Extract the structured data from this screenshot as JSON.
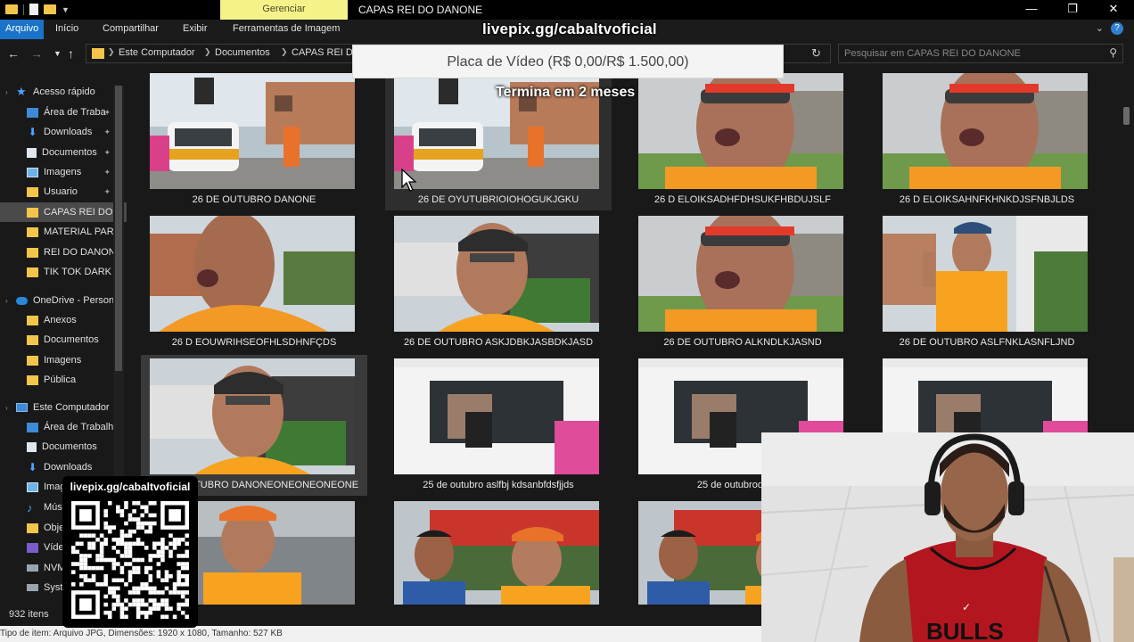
{
  "window": {
    "manage_tab": "Gerenciar",
    "title": "CAPAS REI DO DANONE"
  },
  "ribbon": {
    "tabs": [
      "Arquivo",
      "Início",
      "Compartilhar",
      "Exibir",
      "Ferramentas de Imagem"
    ]
  },
  "address": {
    "crumbs": [
      "Este Computador",
      "Documentos",
      "CAPAS REI DO"
    ]
  },
  "search": {
    "placeholder": "Pesquisar em CAPAS REI DO DANONE"
  },
  "sidebar": {
    "items": [
      {
        "label": "Acesso rápido",
        "icon": "star-icon",
        "pinned": false
      },
      {
        "label": "Área de Traba",
        "icon": "desktop-icon",
        "pinned": true
      },
      {
        "label": "Downloads",
        "icon": "download-icon",
        "pinned": true
      },
      {
        "label": "Documentos",
        "icon": "document-icon",
        "pinned": true
      },
      {
        "label": "Imagens",
        "icon": "image-icon",
        "pinned": true
      },
      {
        "label": "Usuario",
        "icon": "folder-icon",
        "pinned": true
      },
      {
        "label": "CAPAS REI DO D",
        "icon": "folder-icon",
        "pinned": false
      },
      {
        "label": "MATERIAL PARA",
        "icon": "folder-icon",
        "pinned": false
      },
      {
        "label": "REI DO DANONE",
        "icon": "folder-icon",
        "pinned": false
      },
      {
        "label": "TIK TOK DARK D",
        "icon": "folder-icon",
        "pinned": false
      },
      {
        "label": "OneDrive - Person",
        "icon": "cloud-icon",
        "pinned": false
      },
      {
        "label": "Anexos",
        "icon": "folder-icon",
        "pinned": false
      },
      {
        "label": "Documentos",
        "icon": "folder-icon",
        "pinned": false
      },
      {
        "label": "Imagens",
        "icon": "folder-icon",
        "pinned": false
      },
      {
        "label": "Pública",
        "icon": "folder-icon",
        "pinned": false
      },
      {
        "label": "Este Computador",
        "icon": "computer-icon",
        "pinned": false
      },
      {
        "label": "Área de Trabalho",
        "icon": "desktop-icon",
        "pinned": false
      },
      {
        "label": "Documentos",
        "icon": "document-icon",
        "pinned": false
      },
      {
        "label": "Downloads",
        "icon": "download-icon",
        "pinned": false
      },
      {
        "label": "Imag",
        "icon": "image-icon",
        "pinned": false
      },
      {
        "label": "Músi",
        "icon": "music-icon",
        "pinned": false
      },
      {
        "label": "Obje",
        "icon": "folder-icon",
        "pinned": false
      },
      {
        "label": "Víde",
        "icon": "video-icon",
        "pinned": false
      },
      {
        "label": "NVM",
        "icon": "drive-icon",
        "pinned": false
      },
      {
        "label": "Syste",
        "icon": "drive-icon",
        "pinned": false
      }
    ]
  },
  "files": [
    {
      "name": "26 DE OUTUBRO DANONE",
      "scene": "van"
    },
    {
      "name": "26 DE OYUTUBRIOIOHOGUKJGKU",
      "scene": "van"
    },
    {
      "name": "26 D ELOIKSADHFDHSUKFHBDUJSLF",
      "scene": "closeup"
    },
    {
      "name": "26 D ELOIKSAHNFKHNKDJSFNBJLDS",
      "scene": "closeup"
    },
    {
      "name": "26 D EOUWRIHSEOFHLSDHNFÇDS",
      "scene": "face"
    },
    {
      "name": "26 DE OUTUBRO ASKJDBKJASBDKJASD",
      "scene": "cap"
    },
    {
      "name": "26 DE OUTUBRO ALKNDLKJASND",
      "scene": "closeup"
    },
    {
      "name": "26 DE OUTUBRO ASLFNKLASNFLJND",
      "scene": "gesture"
    },
    {
      "name": "26 DE OUTUBRO DANONEONEONEONEONE",
      "scene": "cap"
    },
    {
      "name": "25 de outubro aslfbj kdsanbfdsfjjds",
      "scene": "truck"
    },
    {
      "name": "25 de outubrodnjsfjnl",
      "scene": "truck"
    },
    {
      "name": "",
      "scene": "truck"
    },
    {
      "name": "",
      "scene": "car"
    },
    {
      "name": "",
      "scene": "market"
    },
    {
      "name": "",
      "scene": "market"
    },
    {
      "name": "",
      "scene": "market"
    }
  ],
  "status": {
    "count": "932 itens",
    "details": "Tipo de item: Arquivo JPG, Dimensões: 1920 x 1080, Tamanho: 527 KB"
  },
  "overlay": {
    "site": "livepix.gg/cabaltvoficial",
    "goal": "Placa de Vídeo (R$ 0,00/R$ 1.500,00)",
    "subtitle": "Termina em 2 meses",
    "qr_label": "livepix.gg/cabaltvoficial"
  },
  "colors": {
    "accent": "#1a73c8",
    "manage_tab": "#f5f28a",
    "background": "#191919",
    "folder": "#f3c54a"
  }
}
